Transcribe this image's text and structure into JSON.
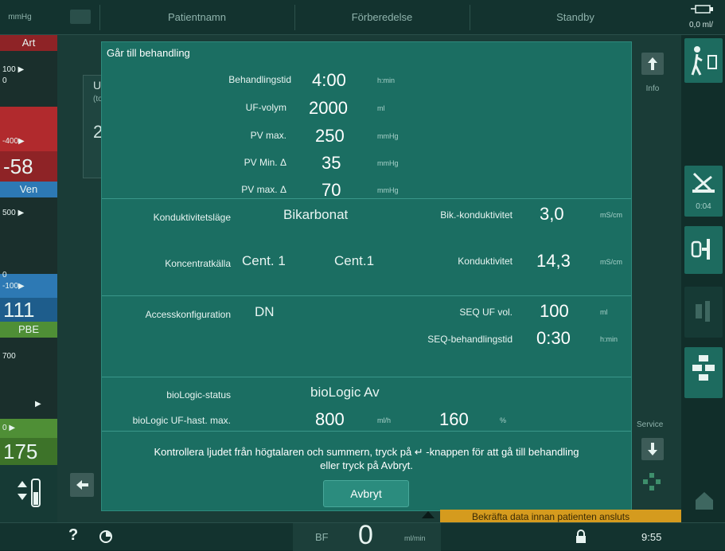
{
  "top_bar": {
    "unit": "mmHg",
    "tabs": [
      "Patientnamn",
      "Förberedelse",
      "Standby"
    ],
    "right_readout": "0,0  ml/"
  },
  "left_gauges": {
    "art": {
      "label": "Art",
      "top_scale": "100 ▶",
      "zero": "0",
      "bottom_scale": "-400▶",
      "value": "-58",
      "color": "#b12a2d"
    },
    "ven": {
      "label": "Ven",
      "top_scale": "500 ▶",
      "zero": "0",
      "bottom_scale": "-100▶",
      "value": "111",
      "color": "#2d79b4"
    },
    "pbe": {
      "label": "PBE",
      "top_scale": "700",
      "arrow": "▶",
      "zero": "0 ▶",
      "value": "175",
      "color": "#4f8f36"
    }
  },
  "background": {
    "uf_label": "U",
    "uf_sub": "(to",
    "uf_value": "2"
  },
  "dialog": {
    "title": "Går till behandling",
    "section1": [
      {
        "label": "Behandlingstid",
        "value": "4:00",
        "unit": "h:min"
      },
      {
        "label": "UF-volym",
        "value": "2000",
        "unit": "ml"
      },
      {
        "label": "PV max.",
        "value": "250",
        "unit": "mmHg"
      },
      {
        "label": "PV Min. Δ",
        "value": "35",
        "unit": "mmHg"
      },
      {
        "label": "PV max. Δ",
        "value": "70",
        "unit": "mmHg"
      }
    ],
    "section2": {
      "mode_label": "Konduktivitetsläge",
      "mode_value": "Bikarbonat",
      "bic_label": "Bik.-konduktivitet",
      "bic_value": "3,0",
      "bic_unit": "mS/cm",
      "source_label": "Koncentratkälla",
      "source_value1": "Cent. 1",
      "source_value2": "Cent.1",
      "cond_label": "Konduktivitet",
      "cond_value": "14,3",
      "cond_unit": "mS/cm"
    },
    "section3": {
      "access_label": "Accesskonfiguration",
      "access_value": "DN",
      "sequf_label": "SEQ UF vol.",
      "sequf_value": "100",
      "sequf_unit": "ml",
      "seqtime_label": "SEQ-behandlingstid",
      "seqtime_value": "0:30",
      "seqtime_unit": "h:min"
    },
    "section4": {
      "status_label": "bioLogic-status",
      "status_value": "bioLogic Av",
      "rate_label": "bioLogic UF-hast. max.",
      "rate_value": "800",
      "rate_unit": "ml/h",
      "pct_value": "160",
      "pct_unit": "%"
    },
    "message_line1": "Kontrollera ljudet från högtalaren och summern, tryck på ↵ -knappen för att gå till behandling",
    "message_line2": "eller tryck på Avbryt.",
    "cancel_label": "Avbryt"
  },
  "right_panel": {
    "info_label": "Info",
    "timer": "0:04",
    "service_label": "Service"
  },
  "bottom_bar": {
    "bf_label": "BF",
    "bf_value": "0",
    "bf_unit": "ml/min",
    "time": "9:55",
    "warning": "Bekräfta data innan patienten ansluts"
  }
}
